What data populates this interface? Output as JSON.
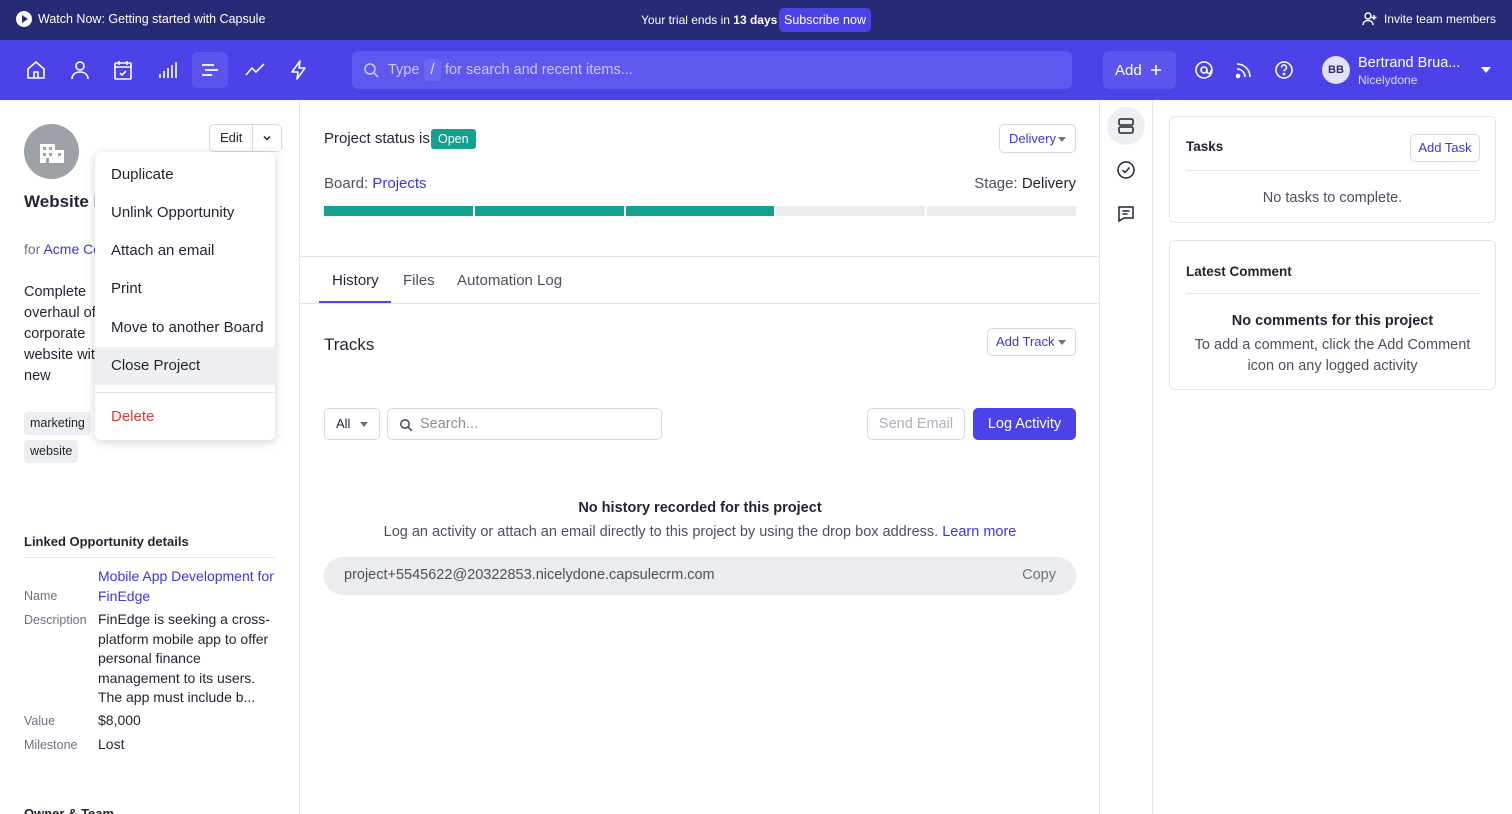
{
  "banner": {
    "watch_label": "Watch Now: Getting started with Capsule",
    "trial_prefix": "Your trial ends in",
    "trial_days": "13 days",
    "subscribe_label": "Subscribe now",
    "invite_label": "Invite team members"
  },
  "nav": {
    "icons": [
      "home-icon",
      "person-icon",
      "calendar-icon",
      "chart-icon",
      "projects-icon",
      "trend-icon",
      "bolt-icon"
    ],
    "active_icon": "projects-icon",
    "search": {
      "type_label": "Type",
      "slash": "/",
      "rest": "for search and recent items..."
    },
    "add_label": "Add",
    "user_initials": "BB",
    "user_name": "Bertrand Brua...",
    "user_org": "Nicelydone"
  },
  "left": {
    "edit_label": "Edit",
    "title": "Website Refresh Project",
    "for_prefix": "for",
    "for_company": "Acme Corp",
    "description": "Complete overhaul of corporate website with new branding, responsive design, and improved navigation.",
    "tags": [
      "marketing",
      "website"
    ],
    "linked_header": "Linked Opportunity details",
    "fields": {
      "name_label": "Name",
      "name_value": "Mobile App Development for FinEdge",
      "description_label": "Description",
      "description_value": "FinEdge is seeking a cross-platform mobile app to offer personal finance management to its users. The app must include b...",
      "value_label": "Value",
      "value_value": "$8,000",
      "milestone_label": "Milestone",
      "milestone_value": "Lost"
    },
    "owner_header": "Owner & Team"
  },
  "menu": {
    "items": [
      "Duplicate",
      "Unlink Opportunity",
      "Attach an email",
      "Print",
      "Move to another Board",
      "Close Project"
    ],
    "highlighted": "Close Project",
    "delete_label": "Delete"
  },
  "main": {
    "status_prefix": "Project status is",
    "status_value": "Open",
    "delivery_label": "Delivery",
    "board_prefix": "Board:",
    "board_value": "Projects",
    "stage_prefix": "Stage:",
    "stage_value": "Delivery",
    "progress": {
      "completed_segments": 3,
      "total_segments": 5
    },
    "tabs": [
      "History",
      "Files",
      "Automation Log"
    ],
    "active_tab": "History",
    "tracks_title": "Tracks",
    "add_track_label": "Add Track",
    "filter_value": "All",
    "search_placeholder": "Search...",
    "send_email_label": "Send Email",
    "log_activity_label": "Log Activity",
    "empty_title": "No history recorded for this project",
    "empty_text": "Log an activity or attach an email directly to this project by using the drop box address.",
    "learn_more": "Learn more",
    "dropbox_address": "project+5545622@20322853.nicelydone.capsulecrm.com",
    "copy_label": "Copy"
  },
  "strip": {
    "icons": [
      "overview-icon",
      "tasks-check-icon",
      "comment-icon"
    ]
  },
  "right": {
    "tasks_title": "Tasks",
    "add_task_label": "Add Task",
    "tasks_empty": "No tasks to complete.",
    "comment_title": "Latest Comment",
    "comment_empty_title": "No comments for this project",
    "comment_empty_text": "To add a comment, click the Add Comment icon on any logged activity"
  },
  "colors": {
    "banner": "#272a74",
    "nav": "#4b42e8",
    "accent": "#4b42e8",
    "status_open": "#13a08e",
    "progress": "#13a08e",
    "danger": "#e5343d"
  }
}
